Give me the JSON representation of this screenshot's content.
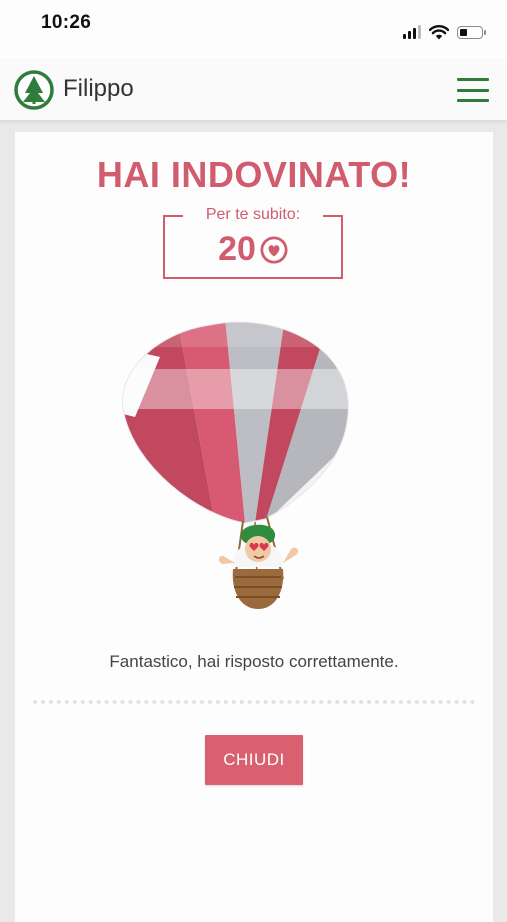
{
  "status_bar": {
    "time": "10:26"
  },
  "header": {
    "brand_name": "Filippo",
    "brand_color": "#2e7d3c"
  },
  "result": {
    "headline": "HAI INDOVINATO!",
    "reward_label": "Per te subito:",
    "reward_value": "20",
    "reward_icon": "heart-coin-icon",
    "message": "Fantastico, hai risposto correttamente.",
    "close_label": "CHIUDI",
    "accent_color": "#d05c6e"
  }
}
